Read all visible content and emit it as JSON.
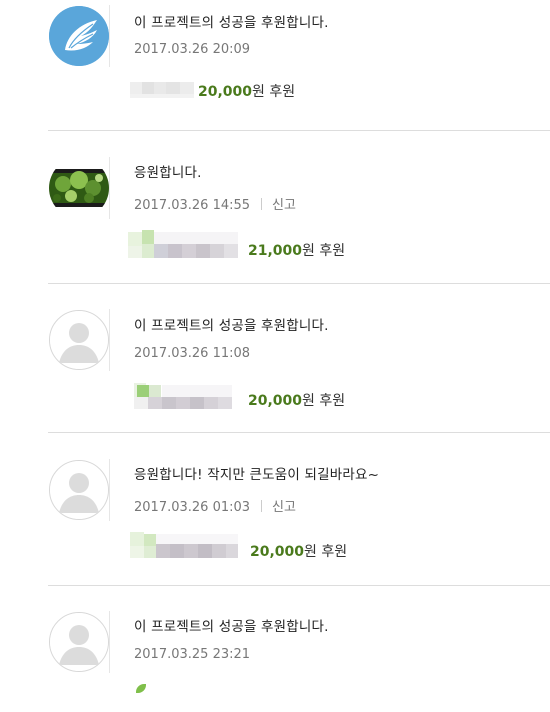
{
  "comments": [
    {
      "message": "이 프로젝트의 성공을 후원합니다.",
      "date": "2017.03.26 20:09",
      "report": "",
      "amount": "20,000",
      "amount_suffix": "원 후원"
    },
    {
      "message": "응원합니다.",
      "date": "2017.03.26 14:55",
      "report": "신고",
      "amount": "21,000",
      "amount_suffix": "원 후원"
    },
    {
      "message": "이 프로젝트의 성공을 후원합니다.",
      "date": "2017.03.26 11:08",
      "report": "",
      "amount": "20,000",
      "amount_suffix": "원 후원"
    },
    {
      "message": "응원합니다! 작지만 큰도움이 되길바라요~",
      "date": "2017.03.26 01:03",
      "report": "신고",
      "amount": "20,000",
      "amount_suffix": "원 후원"
    },
    {
      "message": "이 프로젝트의 성공을 후원합니다.",
      "date": "2017.03.25 23:21",
      "report": "",
      "amount": "",
      "amount_suffix": ""
    }
  ],
  "colors": {
    "amount_green": "#4a7a1c",
    "wing_avatar_blue": "#5ba8dc"
  },
  "icons": {
    "avatar_1": "wing-icon",
    "avatar_2": "photo-avatar",
    "avatar_default": "default-user-icon"
  }
}
